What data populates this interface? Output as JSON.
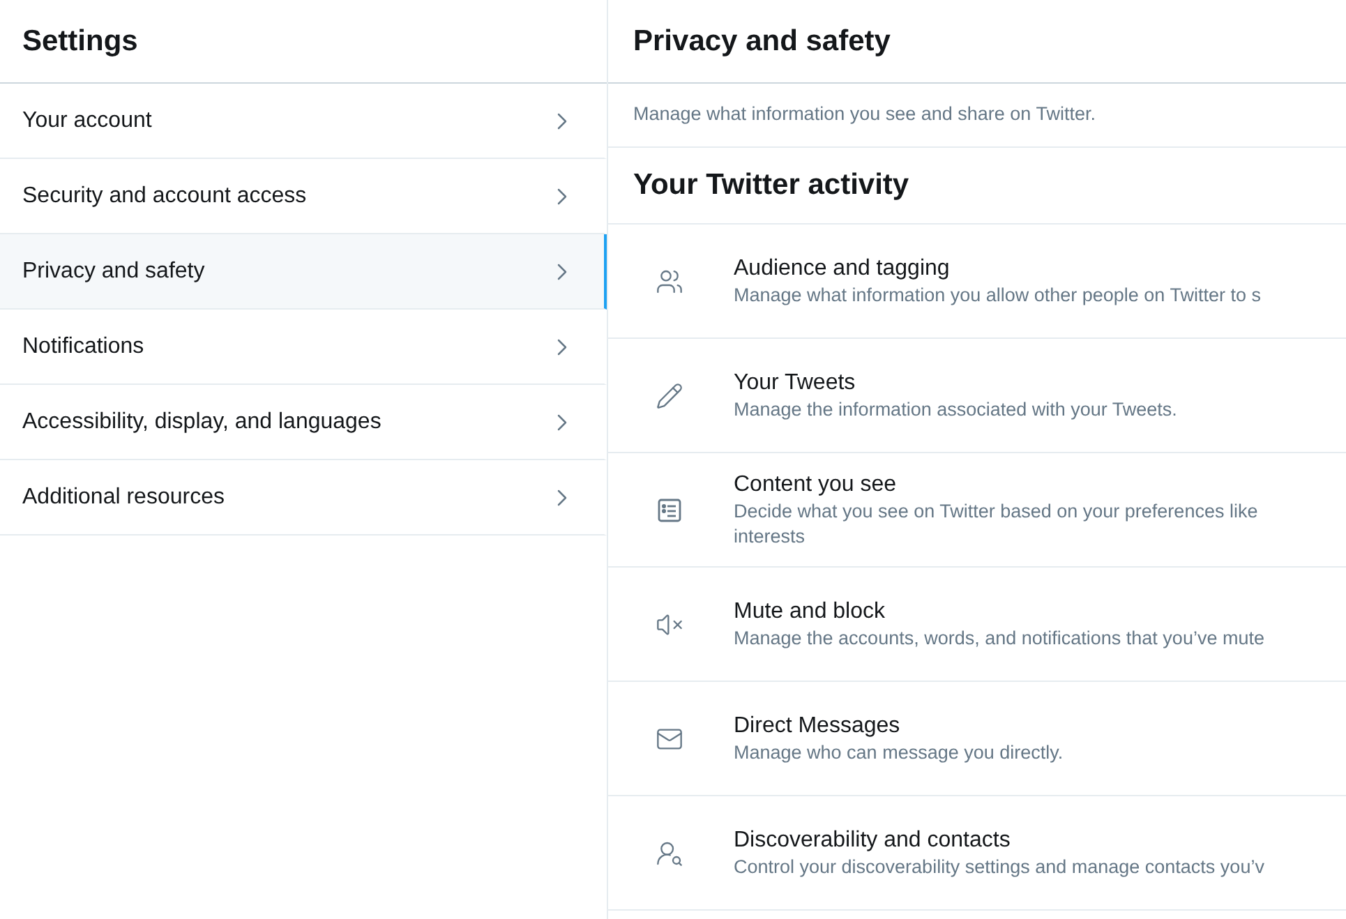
{
  "sidebar": {
    "title": "Settings",
    "items": [
      {
        "label": "Your account",
        "selected": false
      },
      {
        "label": "Security and account access",
        "selected": false
      },
      {
        "label": "Privacy and safety",
        "selected": true
      },
      {
        "label": "Notifications",
        "selected": false
      },
      {
        "label": "Accessibility, display, and languages",
        "selected": false
      },
      {
        "label": "Additional resources",
        "selected": false
      }
    ]
  },
  "main": {
    "title": "Privacy and safety",
    "intro": "Manage what information you see and share on Twitter.",
    "section_title": "Your Twitter activity",
    "items": [
      {
        "kind": "audience",
        "title": "Audience and tagging",
        "description": [
          "Manage what information you allow other people on Twitter to s"
        ]
      },
      {
        "kind": "tweets",
        "title": "Your Tweets",
        "description": [
          "Manage the information associated with your Tweets."
        ]
      },
      {
        "kind": "content",
        "title": "Content you see",
        "description": [
          "Decide what you see on Twitter based on your preferences like",
          "interests"
        ]
      },
      {
        "kind": "mute",
        "title": "Mute and block",
        "description": [
          "Manage the accounts, words, and notifications that you’ve mute"
        ]
      },
      {
        "kind": "messages",
        "title": "Direct Messages",
        "description": [
          "Manage who can message you directly."
        ]
      },
      {
        "kind": "discoverability",
        "title": "Discoverability and contacts",
        "description": [
          "Control your discoverability settings and manage contacts you’v"
        ]
      }
    ]
  }
}
